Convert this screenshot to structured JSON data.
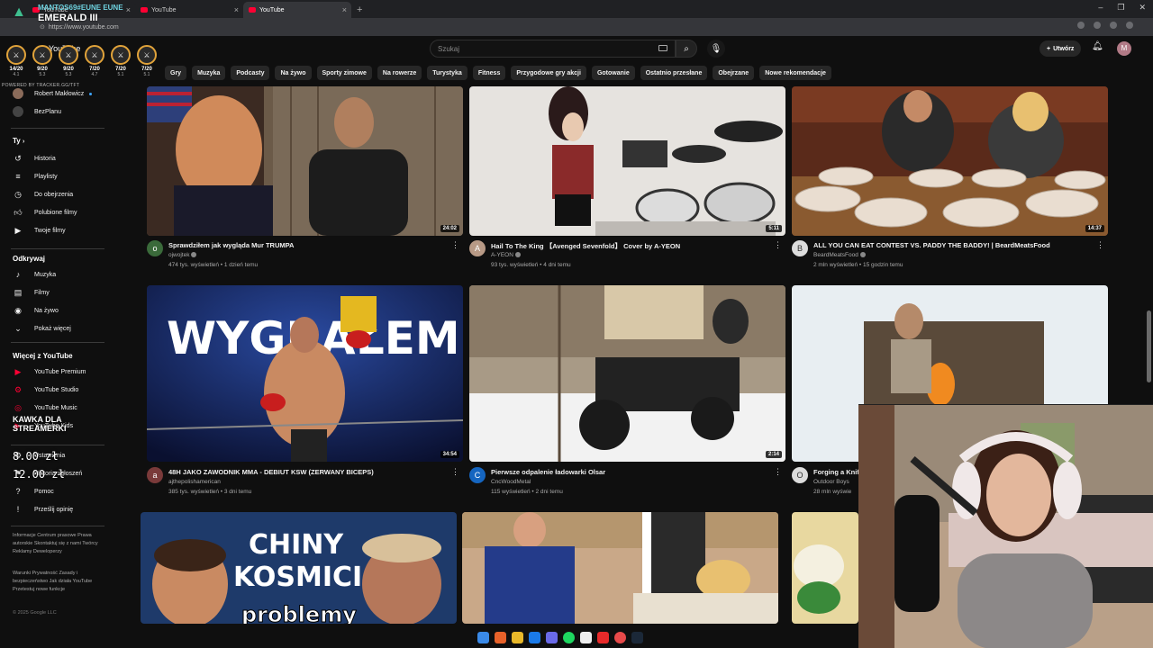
{
  "overlay": {
    "title": "MANTOS69#EUNE EUNE",
    "rank": "EMERALD III",
    "stats": [
      {
        "kda": "14/20",
        "ratio": "4.1",
        "icon": "champion-icon"
      },
      {
        "kda": "9/20",
        "ratio": "5.3",
        "icon": "champion-icon"
      },
      {
        "kda": "9/20",
        "ratio": "5.3",
        "icon": "champion-icon"
      },
      {
        "kda": "7/20",
        "ratio": "4.7",
        "icon": "champion-icon"
      },
      {
        "kda": "7/20",
        "ratio": "5.1",
        "icon": "champion-icon"
      },
      {
        "kda": "7/20",
        "ratio": "5.1",
        "icon": "champion-icon"
      }
    ],
    "powered": "POWERED BY TRACKER.GG/TFT"
  },
  "browser": {
    "tabs": [
      {
        "label": "YouTube",
        "active": false
      },
      {
        "label": "YouTube",
        "active": false
      },
      {
        "label": "YouTube",
        "active": true
      }
    ],
    "url": "https://www.youtube.com"
  },
  "header": {
    "logo_text": "YouTube",
    "search_placeholder": "Szukaj",
    "create_label": "Utwórz",
    "avatar_letter": "M"
  },
  "chips": [
    "Gry",
    "Muzyka",
    "Podcasty",
    "Na żywo",
    "Sporty zimowe",
    "Na rowerze",
    "Turystyka",
    "Fitness",
    "Przygodowe gry akcji",
    "Gotowanie",
    "Ostatnio przesłane",
    "Obejrzane",
    "Nowe rekomendacje"
  ],
  "sidebar": {
    "subs": [
      "Robert Makłowicz",
      "BezPlanu"
    ],
    "you_heading": "Ty",
    "you_items": [
      {
        "label": "Historia",
        "icon": "history-icon"
      },
      {
        "label": "Playlisty",
        "icon": "playlist-icon"
      },
      {
        "label": "Do obejrzenia",
        "icon": "watch-later-icon"
      },
      {
        "label": "Polubione filmy",
        "icon": "like-icon"
      },
      {
        "label": "Twoje filmy",
        "icon": "your-videos-icon"
      }
    ],
    "explore_heading": "Odkrywaj",
    "explore_items": [
      {
        "label": "Muzyka",
        "icon": "music-icon"
      },
      {
        "label": "Filmy",
        "icon": "film-icon"
      },
      {
        "label": "Na żywo",
        "icon": "live-icon"
      },
      {
        "label": "Pokaż więcej",
        "icon": "chevron-down-icon"
      }
    ],
    "more_heading": "Więcej z YouTube",
    "more_items": [
      {
        "label": "YouTube Premium",
        "icon": "youtube-premium-icon"
      },
      {
        "label": "YouTube Studio",
        "icon": "youtube-studio-icon"
      },
      {
        "label": "YouTube Music",
        "icon": "youtube-music-icon"
      },
      {
        "label": "YouTube Kids",
        "icon": "youtube-kids-icon"
      }
    ],
    "settings_items": [
      {
        "label": "Ustawienia",
        "icon": "gear-icon"
      },
      {
        "label": "Historia zgłoszeń",
        "icon": "flag-icon"
      },
      {
        "label": "Pomoc",
        "icon": "help-icon"
      },
      {
        "label": "Prześlij opinię",
        "icon": "feedback-icon"
      }
    ],
    "footer1": "Informacje  Centrum prasowe  Prawa autorskie  Skontaktuj się z nami  Twórcy  Reklamy  Deweloperzy",
    "footer2": "Warunki  Prywatność  Zasady i bezpieczeństwo  Jak działa YouTube  Przetestuj nowe funkcje",
    "copyright": "© 2025 Google LLC",
    "coffee_title": "KAWKA DLA STREAMERKI",
    "coffee_price1": "8.00 zł",
    "coffee_price2": "12.00 zł"
  },
  "videos": [
    {
      "title": "Sprawdziłem jak wygląda Mur TRUMPA",
      "channel": "ojwojtek",
      "meta": "474 tys. wyświetleń • 1 dzień temu",
      "duration": "24:02",
      "avatar": "o"
    },
    {
      "title": "Hail To The King 【Avenged Sevenfold】 Cover by A-YEON",
      "channel": "A-YEON",
      "meta": "93 tys. wyświetleń • 4 dni temu",
      "duration": "5:11",
      "avatar": "A"
    },
    {
      "title": "ALL YOU CAN EAT CONTEST VS. PADDY THE BADDY! | BeardMeatsFood",
      "channel": "BeardMeatsFood",
      "meta": "2 mln wyświetleń • 15 godzin temu",
      "duration": "14:37",
      "avatar": "B"
    },
    {
      "title": "48H JAKO ZAWODNIK MMA - DEBIUT KSW (ZERWANY BICEPS)",
      "channel": "ajthepolishamerican",
      "meta": "385 tys. wyświetleń • 3 dni temu",
      "duration": "34:54",
      "avatar": "a"
    },
    {
      "title": "Pierwsze odpalenie ładowarki Olsar",
      "channel": "CncWoodMetal",
      "meta": "115 wyświetleń • 2 dni temu",
      "duration": "2:14",
      "avatar": "C"
    },
    {
      "title": "Forging a Knif",
      "channel": "Outdoor Boys",
      "meta": "28 mln wyświe",
      "duration": "",
      "avatar": "O"
    }
  ],
  "thumb_text": {
    "wygralem": "WYGRAŁEM",
    "chiny": "CHINY",
    "kosmici": "KOSMICI",
    "problemy": "problemy"
  }
}
